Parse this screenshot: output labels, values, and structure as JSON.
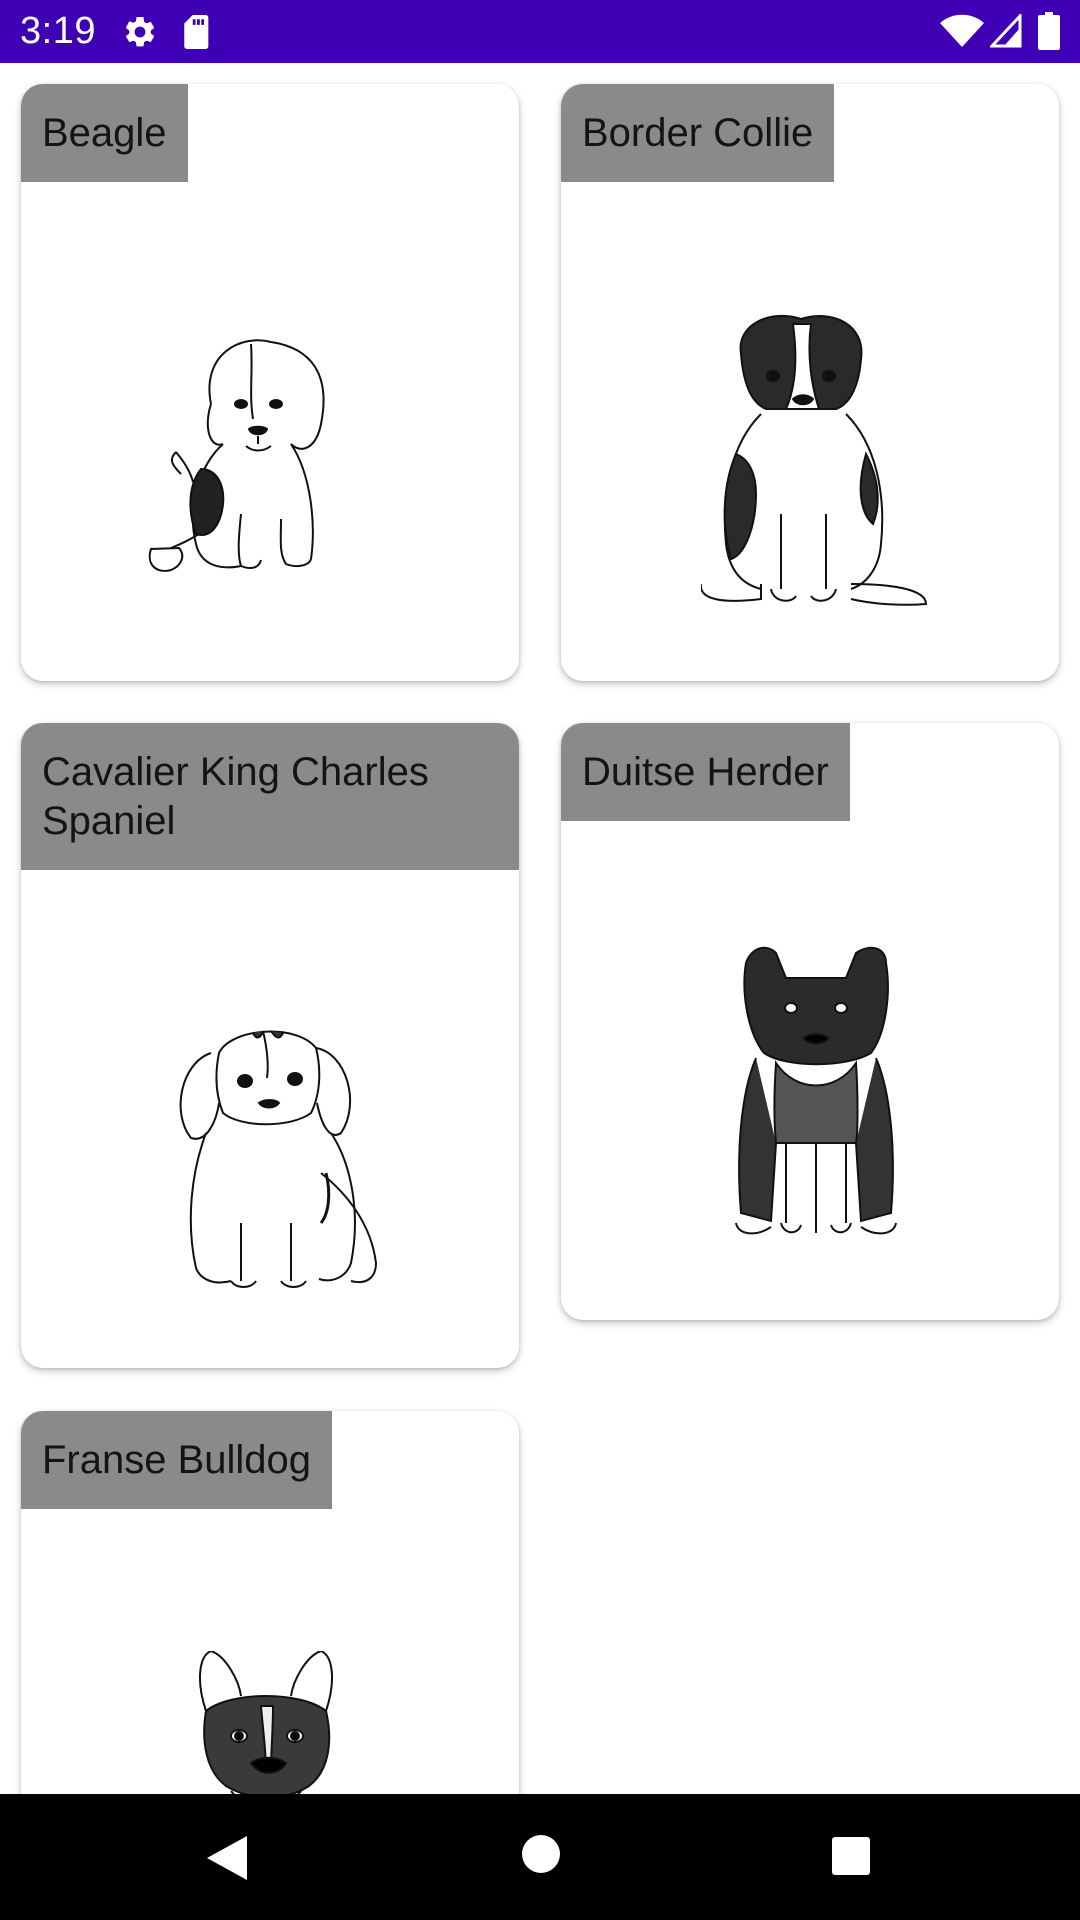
{
  "status_bar": {
    "time": "3:19",
    "background": "#3f00b5",
    "icons": [
      "settings-gear-icon",
      "sd-card-icon",
      "wifi-icon",
      "cell-signal-icon",
      "battery-icon"
    ]
  },
  "breeds": [
    {
      "name": "Beagle",
      "image": "beagle-sketch"
    },
    {
      "name": "Border Collie",
      "image": "border-collie-sketch"
    },
    {
      "name": "Cavalier King Charles Spaniel",
      "image": "cavalier-sketch"
    },
    {
      "name": "Duitse Herder",
      "image": "german-shepherd-sketch"
    },
    {
      "name": "Franse Bulldog",
      "image": "french-bulldog-sketch"
    }
  ],
  "colors": {
    "label_background": "#8a8a8a",
    "card_background": "#ffffff",
    "nav_background": "#000000"
  },
  "nav_bar": {
    "buttons": [
      "back-icon",
      "home-icon",
      "recents-icon"
    ]
  }
}
